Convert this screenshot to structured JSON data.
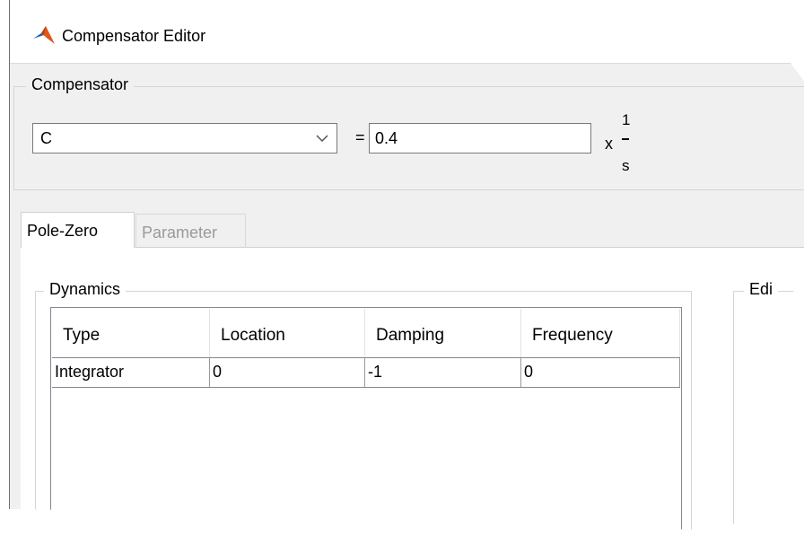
{
  "window": {
    "title": "Compensator Editor"
  },
  "compensator": {
    "group_label": "Compensator",
    "selected": "C",
    "equals": "=",
    "gain": "0.4",
    "times": "x",
    "tf_numerator": "1",
    "tf_denominator": "s"
  },
  "tabs": [
    {
      "label": "Pole-Zero",
      "active": true
    },
    {
      "label": "Parameter",
      "active": false
    }
  ],
  "dynamics": {
    "group_label": "Dynamics",
    "columns": [
      "Type",
      "Location",
      "Damping",
      "Frequency"
    ],
    "rows": [
      [
        "Integrator",
        "0",
        "-1",
        "0"
      ]
    ]
  },
  "edit": {
    "group_label_partial": "Edi"
  },
  "colors": {
    "accent_orange": "#e0561b",
    "accent_blue": "#0a5aa8"
  }
}
